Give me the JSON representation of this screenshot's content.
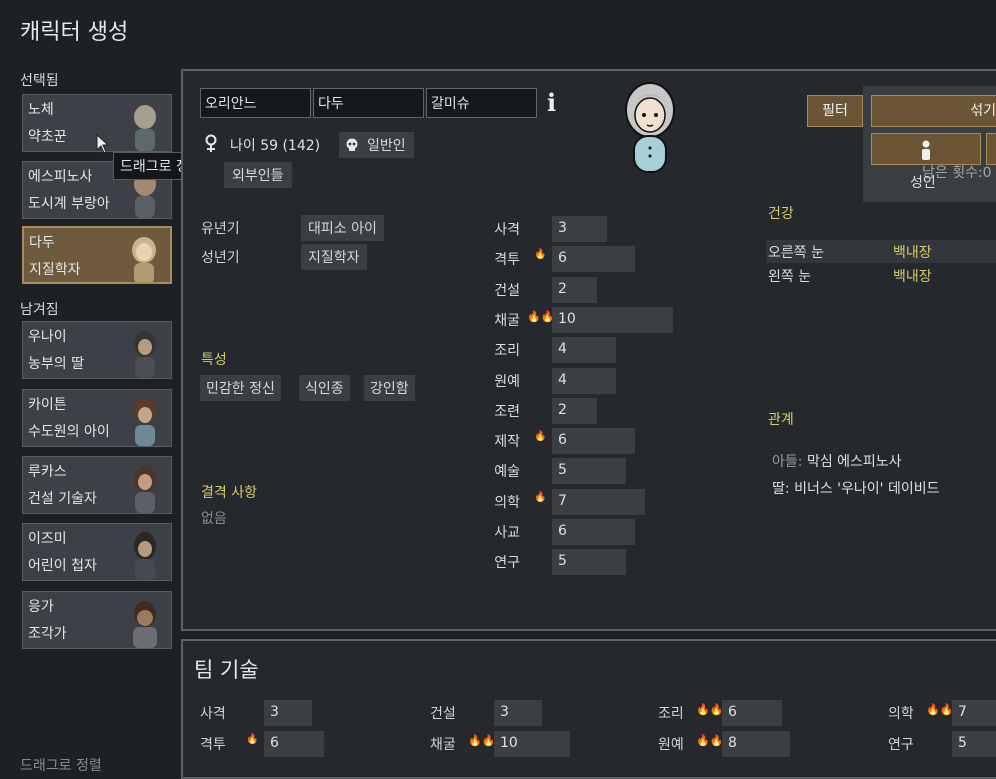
{
  "title": "캐릭터 생성",
  "selected_label": "선택됨",
  "left_label": "남겨짐",
  "drag_sort": "드래그로 정렬",
  "tooltip": "드래그로 정렬",
  "selected_pawns": [
    {
      "name": "노체",
      "role": "약초꾼"
    },
    {
      "name": "에스피노사",
      "role": "도시계 부랑아"
    },
    {
      "name": "다두",
      "role": "지질학자"
    }
  ],
  "left_pawns": [
    {
      "name": "우나이",
      "role": "농부의 딸"
    },
    {
      "name": "카이튼",
      "role": "수도원의 아이"
    },
    {
      "name": "루카스",
      "role": "건설 기술자"
    },
    {
      "name": "이즈미",
      "role": "어린이 첩자"
    },
    {
      "name": "응가",
      "role": "조각가"
    }
  ],
  "character": {
    "first": "오리안느",
    "nick": "다두",
    "last": "갈미슈",
    "info_icon": "i",
    "age": "나이 59 (142)",
    "xeno": "일반인",
    "faction": "외부인들"
  },
  "backstory": {
    "childhood_label": "유년기",
    "childhood_value": "대피소 아이",
    "adulthood_label": "성년기",
    "adulthood_value": "지질학자"
  },
  "traits": {
    "label": "특성",
    "items": [
      "민감한 정신",
      "식인종",
      "강인함"
    ]
  },
  "incapable": {
    "label": "결격 사항",
    "value": "없음"
  },
  "skills": [
    {
      "name": "사격",
      "value": "3",
      "passion": 0,
      "level": 3
    },
    {
      "name": "격투",
      "value": "6",
      "passion": 1,
      "level": 6
    },
    {
      "name": "건설",
      "value": "2",
      "passion": 0,
      "level": 2
    },
    {
      "name": "채굴",
      "value": "10",
      "passion": 2,
      "level": 10
    },
    {
      "name": "조리",
      "value": "4",
      "passion": 0,
      "level": 4
    },
    {
      "name": "원예",
      "value": "4",
      "passion": 0,
      "level": 4
    },
    {
      "name": "조련",
      "value": "2",
      "passion": 0,
      "level": 2
    },
    {
      "name": "제작",
      "value": "6",
      "passion": 1,
      "level": 6
    },
    {
      "name": "예술",
      "value": "5",
      "passion": 0,
      "level": 5
    },
    {
      "name": "의학",
      "value": "7",
      "passion": 1,
      "level": 7
    },
    {
      "name": "사교",
      "value": "6",
      "passion": 0,
      "level": 6
    },
    {
      "name": "연구",
      "value": "5",
      "passion": 0,
      "level": 5
    }
  ],
  "health": {
    "label": "건강",
    "rows": [
      {
        "part": "오른쪽 눈",
        "status": "백내장"
      },
      {
        "part": "왼쪽 눈",
        "status": "백내장"
      }
    ]
  },
  "relations": {
    "label": "관계",
    "items": [
      {
        "rel": "아들:",
        "who": "막심 에스피노사"
      },
      {
        "rel": "딸:",
        "who": "비너스 '우나이' 데이비드"
      }
    ]
  },
  "controls": {
    "filter": "필터",
    "shuffle": "섞기",
    "adult": "성인",
    "remaining": "남은 횟수:0"
  },
  "team": {
    "title": "팀 기술",
    "skills": [
      {
        "name": "사격",
        "value": "3",
        "passion": 0
      },
      {
        "name": "격투",
        "value": "6",
        "passion": 1
      },
      {
        "name": "건설",
        "value": "3",
        "passion": 0
      },
      {
        "name": "채굴",
        "value": "10",
        "passion": 2
      },
      {
        "name": "조리",
        "value": "6",
        "passion": 2
      },
      {
        "name": "원예",
        "value": "8",
        "passion": 2
      },
      {
        "name": "의학",
        "value": "7",
        "passion": 2
      },
      {
        "name": "연구",
        "value": "5",
        "passion": 0
      }
    ]
  },
  "colors": {
    "selected_pawn": "#6e5b3e",
    "section_header": "#d6cc6a",
    "passion": "#f2a321"
  }
}
